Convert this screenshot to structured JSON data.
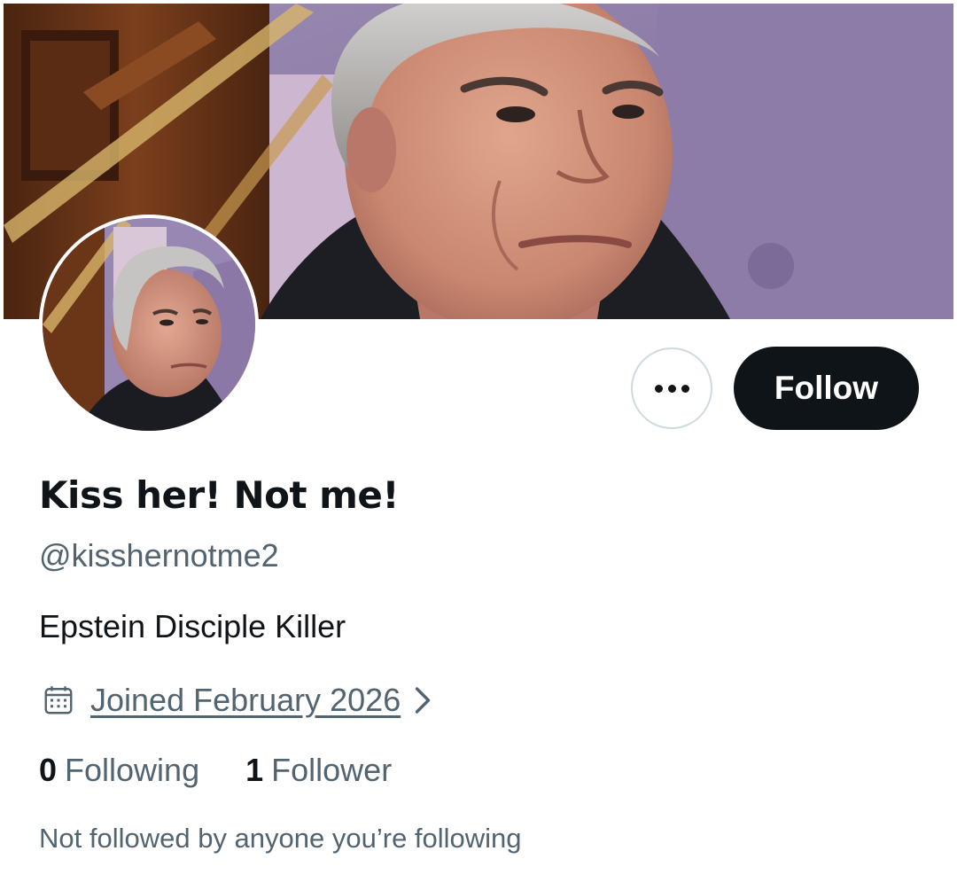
{
  "profile": {
    "display_name": "Kiss her! Not me!",
    "handle": "@kisshernotme2",
    "bio": "Epstein Disciple Killer",
    "joined": "Joined February 2026",
    "following_count": "0",
    "following_label": "Following",
    "followers_count": "1",
    "followers_label": "Follower",
    "followed_by_text": "Not followed by anyone you’re following"
  },
  "actions": {
    "follow_label": "Follow",
    "more_icon": "more-horizontal-icon"
  },
  "icons": {
    "joined": "calendar-icon",
    "joined_chevron": "chevron-right-icon"
  },
  "colors": {
    "text_primary": "#0f1419",
    "text_secondary": "#536471",
    "follow_button_bg": "#0f1419",
    "border": "#cfd9de",
    "banner_purple": "#8c7ba6"
  }
}
